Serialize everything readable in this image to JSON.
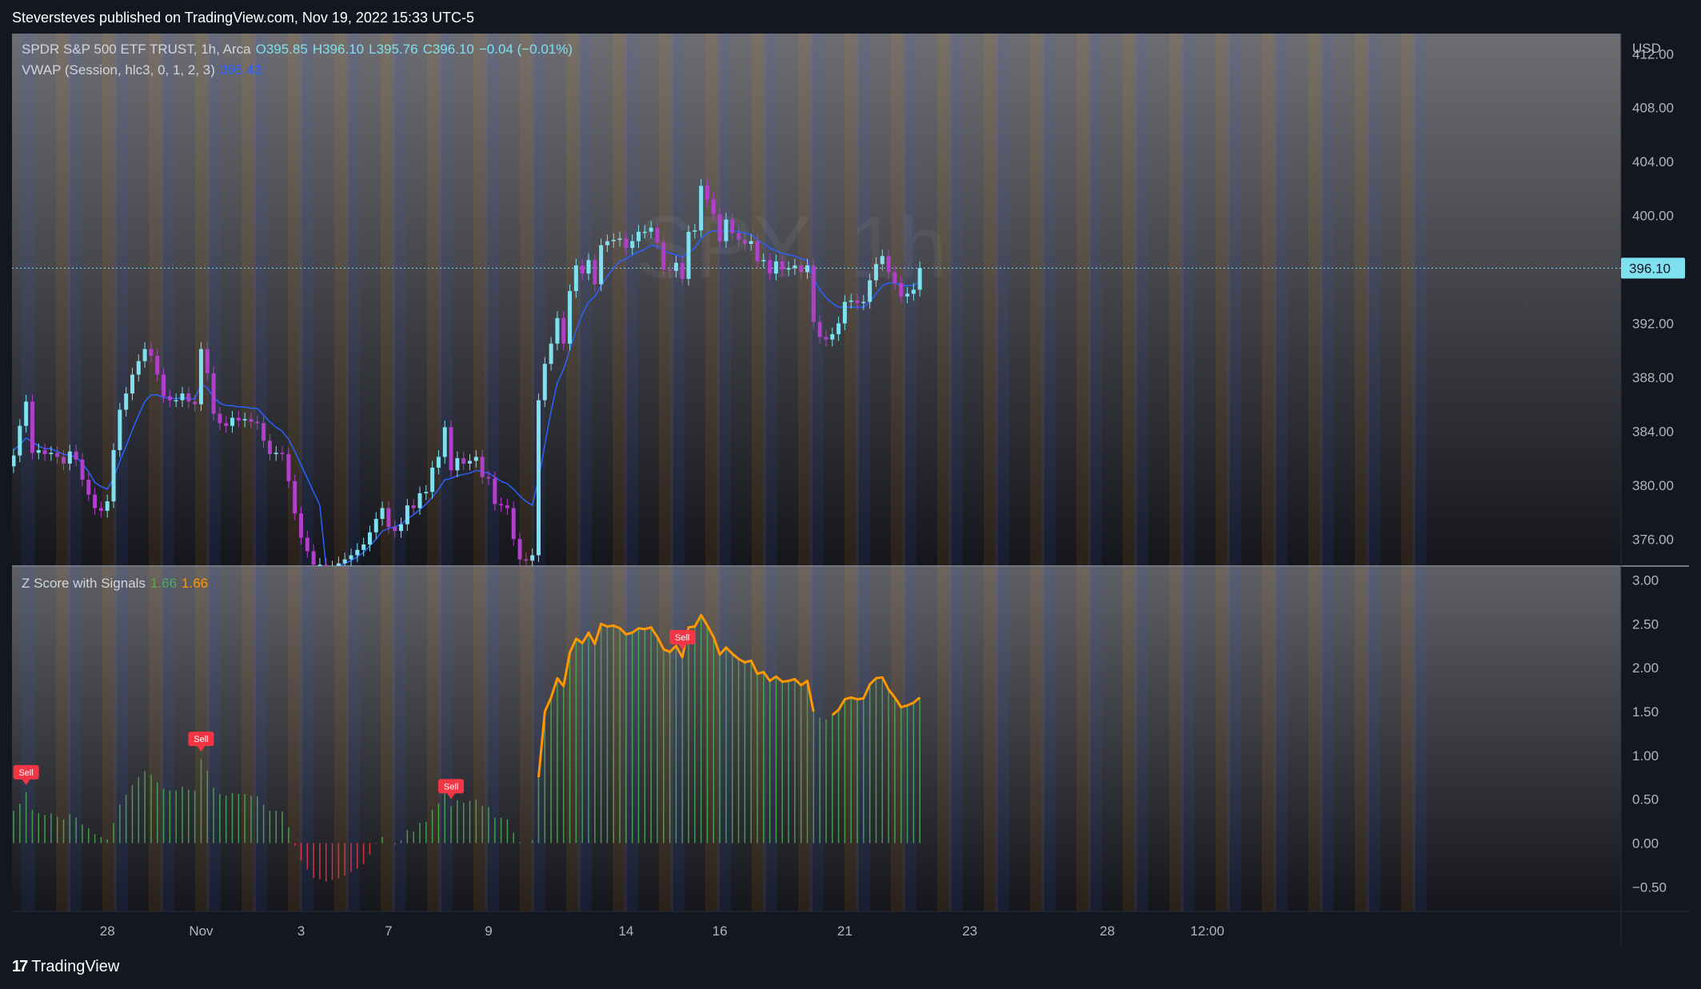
{
  "header": {
    "published_line": "Steversteves published on TradingView.com, Nov 19, 2022 15:33 UTC-5"
  },
  "main_legend": {
    "symbol_line": "SPDR S&P 500 ETF TRUST, 1h, Arca",
    "open": "O395.85",
    "high": "H396.10",
    "low": "L395.76",
    "close": "C396.10",
    "change": "−0.04 (−0.01%)",
    "vwap_label": "VWAP (Session, hlc3, 0, 1, 2, 3)",
    "vwap_value": "395.43"
  },
  "sub_legend": {
    "title": "Z Score with Signals",
    "value1": "1.66",
    "value2": "1.66"
  },
  "watermark": "SPY, 1h",
  "currency": "USD",
  "last_price": "396.10",
  "sell_label": "Sell",
  "footer": {
    "brand": "TradingView"
  },
  "colors": {
    "background": "#131722",
    "candle_up": "#7fe0f0",
    "candle_down": "#b03fc9",
    "vwap": "#2962ff",
    "zscore_line": "#ff9800",
    "hist_positive": "#4caf50",
    "hist_negative": "#f23645",
    "sell_badge": "#f23645",
    "session_orange": "#ff9800",
    "session_blue": "#2962ff"
  },
  "chart_data": [
    {
      "type": "candlestick",
      "title": "SPDR S&P 500 ETF TRUST, 1h, Arca",
      "ylabel": "USD",
      "ylim": [
        374.0,
        413.5
      ],
      "y_ticks": [
        "412.00",
        "408.00",
        "404.00",
        "400.00",
        "396.00",
        "392.00",
        "388.00",
        "384.00",
        "380.00",
        "376.00"
      ],
      "x_ticks": [
        "28",
        "Nov",
        "3",
        "7",
        "9",
        "14",
        "16",
        "21",
        "23",
        "28",
        "12:00"
      ],
      "x_tick_index": [
        15,
        30,
        46,
        60,
        76,
        98,
        113,
        133,
        153,
        175,
        191
      ],
      "closes": [
        382.2,
        384.4,
        386.2,
        382.4,
        382.6,
        382.3,
        382.4,
        382.1,
        381.6,
        382.5,
        381.9,
        380.4,
        379.3,
        378.3,
        378.1,
        378.8,
        382.6,
        385.6,
        386.8,
        388.2,
        389.2,
        390.1,
        389.6,
        388.2,
        386.6,
        386.3,
        386.3,
        386.8,
        386.2,
        386.0,
        390.1,
        388.3,
        385.3,
        384.6,
        384.4,
        385.0,
        384.8,
        384.9,
        384.7,
        384.6,
        383.3,
        382.3,
        382.4,
        382.3,
        380.3,
        377.9,
        376.1,
        375.1,
        374.1,
        374.1,
        373.6,
        373.9,
        374.2,
        374.5,
        374.8,
        375.2,
        375.6,
        376.5,
        377.5,
        378.3,
        376.9,
        376.6,
        377.1,
        378.5,
        378.3,
        379.4,
        379.5,
        381.3,
        382.1,
        384.3,
        381.1,
        382.0,
        381.6,
        381.8,
        382.1,
        380.6,
        380.5,
        378.6,
        378.5,
        378.3,
        376.0,
        374.5,
        374.4,
        374.8,
        386.3,
        389.0,
        390.5,
        392.4,
        390.5,
        394.4,
        396.3,
        395.7,
        396.7,
        394.9,
        397.8,
        398.1,
        398.2,
        398.3,
        397.6,
        398.1,
        398.8,
        398.8,
        399.1,
        398.0,
        396.0,
        395.9,
        396.5,
        395.3,
        398.8,
        398.9,
        402.2,
        401.2,
        400.1,
        398.1,
        399.7,
        398.7,
        398.2,
        397.9,
        398.1,
        396.6,
        396.7,
        395.7,
        396.6,
        396.0,
        396.1,
        396.3,
        395.8,
        396.3,
        392.1,
        391.0,
        390.8,
        391.2,
        392.0,
        393.6,
        393.7,
        393.5,
        393.6,
        395.2,
        396.4,
        397.0,
        395.8,
        395.0,
        394.0,
        394.2,
        394.5,
        396.1
      ],
      "vwap": [
        382.6,
        383.0,
        383.5,
        383.2,
        382.9,
        382.7,
        382.7,
        382.5,
        382.3,
        382.2,
        382.1,
        381.6,
        381.0,
        380.2,
        379.9,
        379.7,
        380.5,
        381.8,
        382.9,
        384.1,
        385.2,
        386.2,
        386.7,
        386.7,
        386.5,
        386.5,
        386.4,
        386.5,
        386.4,
        386.4,
        387.5,
        387.2,
        386.5,
        386.1,
        385.9,
        385.9,
        385.8,
        385.8,
        385.7,
        385.7,
        385.2,
        384.7,
        384.3,
        384.0,
        383.4,
        382.5,
        381.5,
        380.5,
        379.5,
        378.5,
        373.9,
        373.9,
        374.0,
        374.2,
        374.4,
        374.7,
        375.0,
        375.5,
        376.0,
        376.6,
        376.8,
        376.9,
        377.1,
        377.5,
        377.8,
        378.2,
        378.6,
        379.1,
        379.7,
        380.4,
        380.5,
        380.7,
        380.8,
        380.9,
        381.1,
        381.0,
        380.9,
        380.6,
        380.3,
        380.1,
        379.7,
        379.2,
        378.8,
        378.5,
        380.5,
        383.0,
        385.5,
        387.6,
        388.6,
        390.0,
        391.5,
        392.7,
        393.6,
        394.0,
        394.8,
        395.5,
        396.1,
        396.6,
        396.8,
        397.1,
        397.3,
        397.5,
        397.8,
        397.7,
        397.4,
        397.2,
        397.1,
        396.9,
        397.3,
        397.6,
        398.3,
        398.7,
        398.9,
        398.8,
        398.9,
        398.9,
        398.8,
        398.7,
        398.6,
        398.2,
        397.9,
        397.6,
        397.4,
        397.2,
        397.1,
        397.0,
        396.8,
        396.7,
        395.3,
        394.5,
        393.9,
        393.5,
        393.2,
        393.2,
        393.2,
        393.2,
        393.2,
        393.6,
        394.2,
        394.8,
        395.0,
        395.0,
        394.8,
        394.8,
        394.8,
        395.1
      ]
    },
    {
      "type": "bar",
      "title": "Z Score with Signals",
      "ylim": [
        -0.78,
        3.15
      ],
      "y_ticks": [
        "3.00",
        "2.50",
        "2.00",
        "1.50",
        "1.00",
        "0.50",
        "0.00",
        "−0.50"
      ],
      "values": [
        0.37,
        0.45,
        0.58,
        0.38,
        0.34,
        0.32,
        0.34,
        0.3,
        0.27,
        0.33,
        0.29,
        0.21,
        0.17,
        0.1,
        0.07,
        0.04,
        0.23,
        0.44,
        0.55,
        0.66,
        0.75,
        0.82,
        0.78,
        0.69,
        0.62,
        0.6,
        0.6,
        0.64,
        0.61,
        0.6,
        0.96,
        0.83,
        0.63,
        0.56,
        0.54,
        0.57,
        0.56,
        0.56,
        0.54,
        0.53,
        0.44,
        0.37,
        0.37,
        0.36,
        0.18,
        -0.03,
        -0.2,
        -0.3,
        -0.4,
        -0.41,
        -0.44,
        -0.42,
        -0.4,
        -0.37,
        -0.33,
        -0.29,
        -0.24,
        -0.13,
        -0.01,
        0.07,
        0.0,
        -0.02,
        0.03,
        0.15,
        0.13,
        0.23,
        0.24,
        0.38,
        0.45,
        0.61,
        0.42,
        0.49,
        0.46,
        0.48,
        0.5,
        0.42,
        0.41,
        0.29,
        0.29,
        0.27,
        0.12,
        0.01,
        0.0,
        0.03,
        0.75,
        1.5,
        1.66,
        1.88,
        1.79,
        2.17,
        2.33,
        2.28,
        2.4,
        2.27,
        2.5,
        2.47,
        2.48,
        2.45,
        2.38,
        2.4,
        2.45,
        2.44,
        2.46,
        2.35,
        2.21,
        2.18,
        2.25,
        2.12,
        2.46,
        2.47,
        2.6,
        2.48,
        2.35,
        2.15,
        2.23,
        2.16,
        2.1,
        2.06,
        2.08,
        1.93,
        1.95,
        1.85,
        1.9,
        1.84,
        1.85,
        1.87,
        1.8,
        1.85,
        1.5,
        1.43,
        1.41,
        1.46,
        1.52,
        1.64,
        1.66,
        1.64,
        1.65,
        1.81,
        1.88,
        1.89,
        1.75,
        1.66,
        1.55,
        1.57,
        1.6,
        1.66
      ],
      "zscore_line": [
        null,
        null,
        null,
        null,
        null,
        null,
        null,
        null,
        null,
        null,
        null,
        null,
        null,
        null,
        null,
        null,
        null,
        null,
        null,
        null,
        null,
        null,
        null,
        null,
        null,
        null,
        null,
        null,
        null,
        null,
        null,
        null,
        null,
        null,
        null,
        null,
        null,
        null,
        null,
        null,
        null,
        null,
        null,
        null,
        null,
        null,
        null,
        null,
        null,
        null,
        null,
        null,
        null,
        null,
        null,
        null,
        null,
        null,
        null,
        null,
        null,
        null,
        null,
        null,
        null,
        null,
        null,
        null,
        null,
        null,
        null,
        null,
        null,
        null,
        null,
        null,
        null,
        null,
        null,
        null,
        null,
        null,
        null,
        null,
        0.75,
        1.5,
        1.66,
        1.88,
        1.79,
        2.17,
        2.33,
        2.28,
        2.4,
        2.27,
        2.5,
        2.47,
        2.48,
        2.45,
        2.38,
        2.4,
        2.45,
        2.44,
        2.46,
        2.35,
        2.21,
        2.18,
        2.25,
        2.12,
        2.46,
        2.47,
        2.6,
        2.48,
        2.35,
        2.15,
        2.23,
        2.16,
        2.1,
        2.06,
        2.08,
        1.93,
        1.95,
        1.85,
        1.9,
        1.84,
        1.85,
        1.87,
        1.8,
        1.85,
        1.5,
        null,
        null,
        1.46,
        1.52,
        1.64,
        1.66,
        1.64,
        1.65,
        1.81,
        1.88,
        1.89,
        1.75,
        1.66,
        1.55,
        1.57,
        1.6,
        1.66
      ],
      "sell_signals": [
        2,
        30,
        70,
        107
      ]
    }
  ]
}
